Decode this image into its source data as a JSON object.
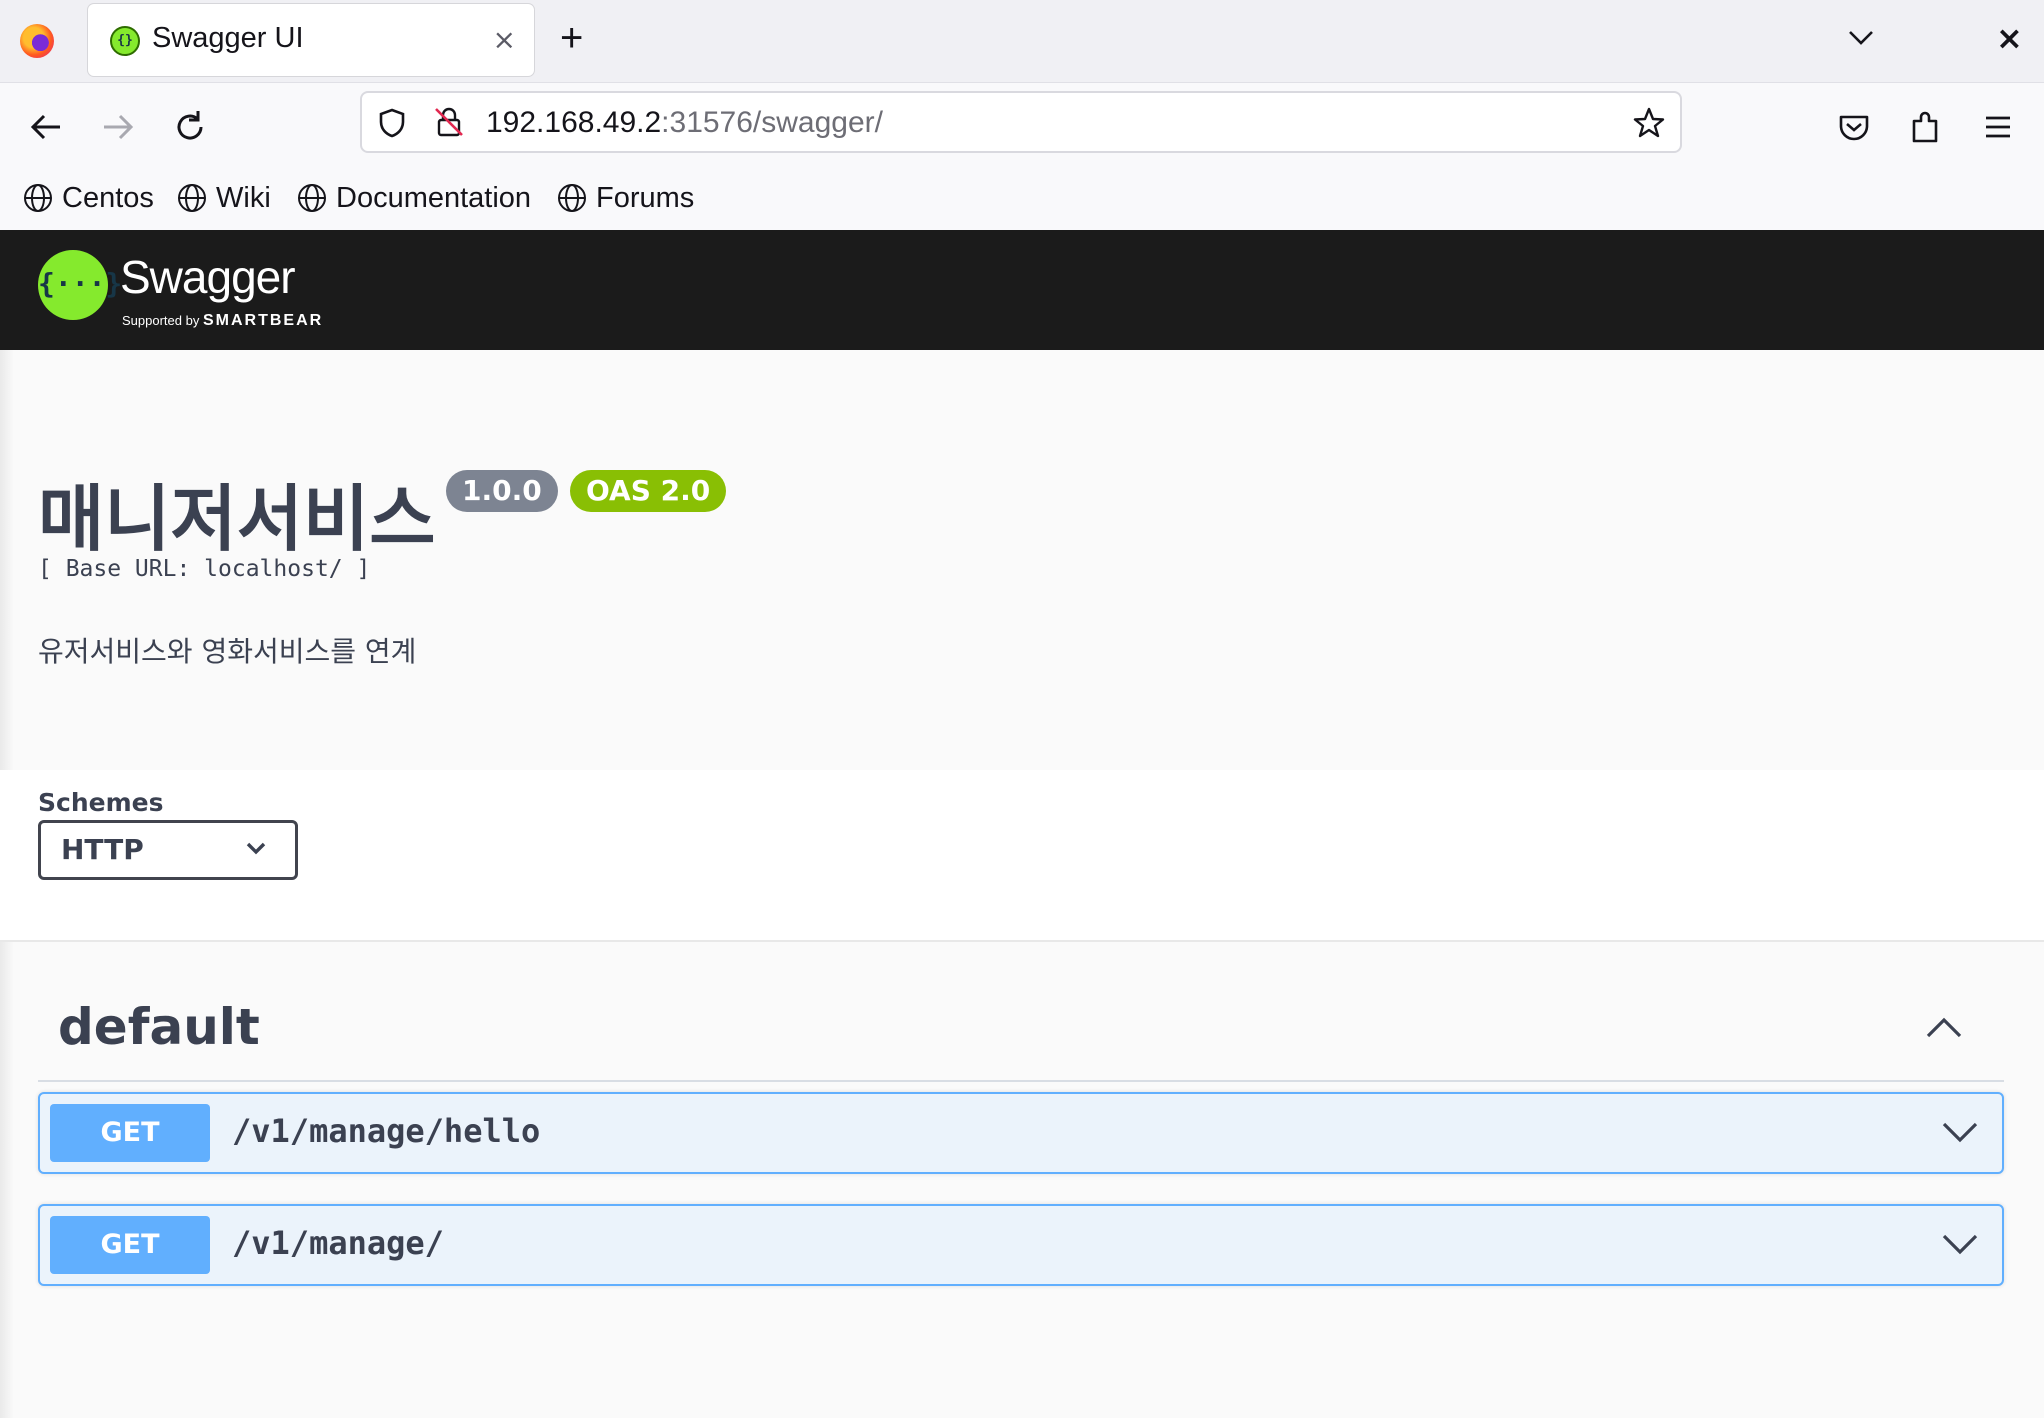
{
  "browser": {
    "tab_title": "Swagger UI",
    "tab_close": "×",
    "new_tab": "+",
    "window_close": "×",
    "url_host": "192.168.49.2",
    "url_rest": ":31576/swagger/",
    "bookmarks": [
      {
        "label": "Centos",
        "icon": "globe-icon"
      },
      {
        "label": "Wiki",
        "icon": "globe-icon"
      },
      {
        "label": "Documentation",
        "icon": "globe-icon"
      },
      {
        "label": "Forums",
        "icon": "globe-icon"
      }
    ]
  },
  "topbar": {
    "logo_glyph": "{···}",
    "brand": "Swagger",
    "supported_by": "Supported by",
    "company": "SMARTBEAR"
  },
  "info": {
    "title": "매니저서비스",
    "version": "1.0.0",
    "spec": "OAS 2.0",
    "base_url": "[ Base URL: localhost/ ]",
    "description": "유저서비스와 영화서비스를 연계"
  },
  "schemes": {
    "label": "Schemes",
    "selected": "HTTP"
  },
  "tag": {
    "name": "default"
  },
  "operations": [
    {
      "method": "GET",
      "path": "/v1/manage/hello"
    },
    {
      "method": "GET",
      "path": "/v1/manage/"
    }
  ],
  "colors": {
    "get": "#61affe",
    "get_bg": "#ebf3fb",
    "version_badge": "#7d8492",
    "spec_badge": "#89bf04",
    "swagger_green": "#85ea2d",
    "topbar_bg": "#1b1b1b"
  }
}
